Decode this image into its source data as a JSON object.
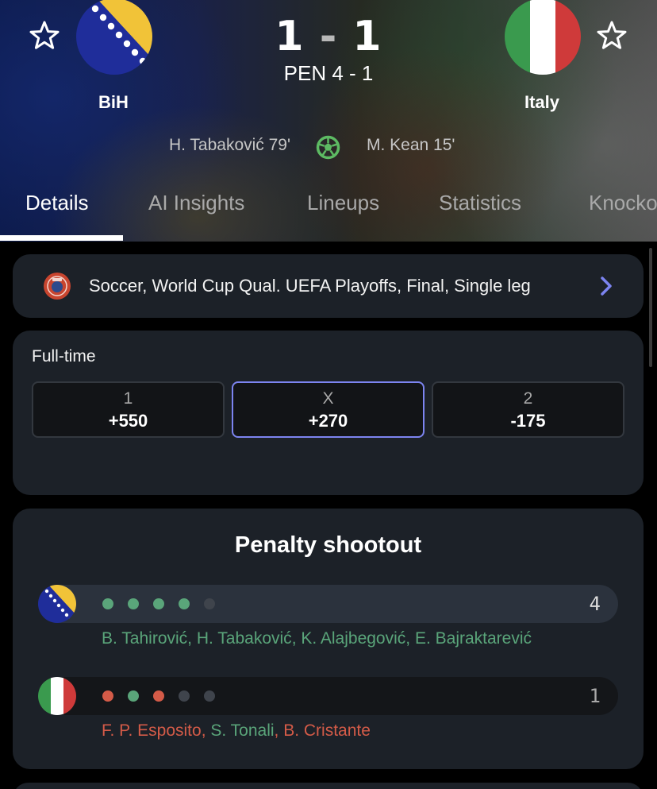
{
  "match": {
    "home_team": "BiH",
    "away_team": "Italy",
    "home_score": "1",
    "away_score": "1",
    "score_separator": "-",
    "penalties": "PEN 4 - 1",
    "home_scorer": "H. Tabaković 79'",
    "away_scorer": "M. Kean 15'"
  },
  "tabs": [
    {
      "label": "Details",
      "active": true
    },
    {
      "label": "AI Insights",
      "active": false
    },
    {
      "label": "Lineups",
      "active": false
    },
    {
      "label": "Statistics",
      "active": false
    },
    {
      "label": "Knockout",
      "active": false
    }
  ],
  "competition": {
    "text": "Soccer, World Cup Qual. UEFA Playoffs, Final, Single leg",
    "icon": "uefa-icon"
  },
  "odds": {
    "title": "Full-time",
    "options": [
      {
        "label": "1",
        "value": "+550",
        "selected": false
      },
      {
        "label": "X",
        "value": "+270",
        "selected": true
      },
      {
        "label": "2",
        "value": "-175",
        "selected": false
      }
    ]
  },
  "penalty_shootout": {
    "title": "Penalty shootout",
    "home": {
      "count": "4",
      "kicks": [
        "scored",
        "scored",
        "scored",
        "scored",
        "pending"
      ],
      "takers": [
        "B. Tahirović",
        "H. Tabaković",
        "K. Alajbegović",
        "E. Bajraktarević"
      ]
    },
    "away": {
      "count": "1",
      "kicks": [
        "missed",
        "scored",
        "missed",
        "pending",
        "pending"
      ],
      "takers": [
        {
          "name": "F. P. Esposito",
          "result": "missed"
        },
        {
          "name": "S. Tonali",
          "result": "scored"
        },
        {
          "name": "B. Cristante",
          "result": "missed"
        }
      ]
    }
  },
  "colors": {
    "scored": "#5aa57a",
    "missed": "#d45b48",
    "pending": "#3f444c",
    "selected_border": "#7c84f0",
    "goal_icon": "#5dbb63"
  }
}
